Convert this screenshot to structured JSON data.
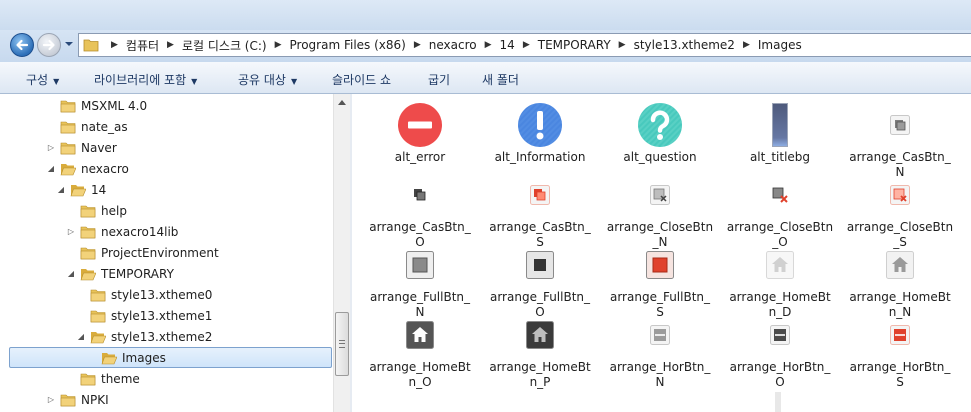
{
  "address": {
    "crumbs": [
      "컴퓨터",
      "로컬 디스크 (C:)",
      "Program Files (x86)",
      "nexacro",
      "14",
      "TEMPORARY",
      "style13.xtheme2",
      "Images"
    ]
  },
  "toolbar": {
    "items": [
      {
        "label": "구성",
        "dropdown": true
      },
      {
        "label": "라이브러리에 포함",
        "dropdown": true
      },
      {
        "label": "공유 대상",
        "dropdown": true
      },
      {
        "label": "슬라이드 쇼",
        "dropdown": false
      },
      {
        "label": "굽기",
        "dropdown": false
      },
      {
        "label": "새 폴더",
        "dropdown": false
      }
    ]
  },
  "tree": [
    {
      "label": "MSXML 4.0",
      "level": 2,
      "toggle": "none"
    },
    {
      "label": "nate_as",
      "level": 2,
      "toggle": "none"
    },
    {
      "label": "Naver",
      "level": 2,
      "toggle": "collapsed"
    },
    {
      "label": "nexacro",
      "level": 2,
      "toggle": "expanded"
    },
    {
      "label": "14",
      "level": 3,
      "toggle": "expanded"
    },
    {
      "label": "help",
      "level": 4,
      "toggle": "none"
    },
    {
      "label": "nexacro14lib",
      "level": 4,
      "toggle": "collapsed"
    },
    {
      "label": "ProjectEnvironment",
      "level": 4,
      "toggle": "none"
    },
    {
      "label": "TEMPORARY",
      "level": 4,
      "toggle": "expanded"
    },
    {
      "label": "style13.xtheme0",
      "level": 5,
      "toggle": "none"
    },
    {
      "label": "style13.xtheme1",
      "level": 5,
      "toggle": "none"
    },
    {
      "label": "style13.xtheme2",
      "level": 5,
      "toggle": "expanded"
    },
    {
      "label": "Images",
      "level": 6,
      "toggle": "none",
      "selected": true
    },
    {
      "label": "theme",
      "level": 4,
      "toggle": "none"
    },
    {
      "label": "NPKI",
      "level": 2,
      "toggle": "collapsed"
    }
  ],
  "files": [
    {
      "lines": [
        "alt_error"
      ],
      "icon": "alt-error-icon"
    },
    {
      "lines": [
        "alt_Information"
      ],
      "icon": "alt-information-icon"
    },
    {
      "lines": [
        "alt_question"
      ],
      "icon": "alt-question-icon"
    },
    {
      "lines": [
        "alt_titlebg"
      ],
      "icon": "titlebg-icon"
    },
    {
      "lines": [
        "arrange_CasBtn_",
        "N"
      ],
      "icon": "cascade-n-icon"
    },
    {
      "lines": [
        "arrange_CasBtn_",
        "O"
      ],
      "icon": "cascade-o-icon"
    },
    {
      "lines": [
        "arrange_CasBtn_",
        "S"
      ],
      "icon": "cascade-s-icon"
    },
    {
      "lines": [
        "arrange_CloseBtn",
        "_N"
      ],
      "icon": "close-n-icon"
    },
    {
      "lines": [
        "arrange_CloseBtn",
        "_O"
      ],
      "icon": "close-o-icon"
    },
    {
      "lines": [
        "arrange_CloseBtn",
        "_S"
      ],
      "icon": "close-s-icon"
    },
    {
      "lines": [
        "arrange_FullBtn_",
        "N"
      ],
      "icon": "full-n-icon"
    },
    {
      "lines": [
        "arrange_FullBtn_",
        "O"
      ],
      "icon": "full-o-icon"
    },
    {
      "lines": [
        "arrange_FullBtn_",
        "S"
      ],
      "icon": "full-s-icon"
    },
    {
      "lines": [
        "arrange_HomeBt",
        "n_D"
      ],
      "icon": "home-d-icon"
    },
    {
      "lines": [
        "arrange_HomeBt",
        "n_N"
      ],
      "icon": "home-n-icon"
    },
    {
      "lines": [
        "arrange_HomeBt",
        "n_O"
      ],
      "icon": "home-o-icon"
    },
    {
      "lines": [
        "arrange_HomeBt",
        "n_P"
      ],
      "icon": "home-p-icon"
    },
    {
      "lines": [
        "arrange_HorBtn_",
        "N"
      ],
      "icon": "horizontal-n-icon"
    },
    {
      "lines": [
        "arrange_HorBtn_",
        "O"
      ],
      "icon": "horizontal-o-icon"
    },
    {
      "lines": [
        "arrange_HorBtn_",
        "S"
      ],
      "icon": "horizontal-s-icon"
    }
  ],
  "colors": {
    "folder": "#e8c35a",
    "error": "#ee4b4b",
    "information": "#4a86e0",
    "question": "#48c9bd",
    "selected_active": "#e0412c",
    "toolbar_text": "#1e3964"
  }
}
